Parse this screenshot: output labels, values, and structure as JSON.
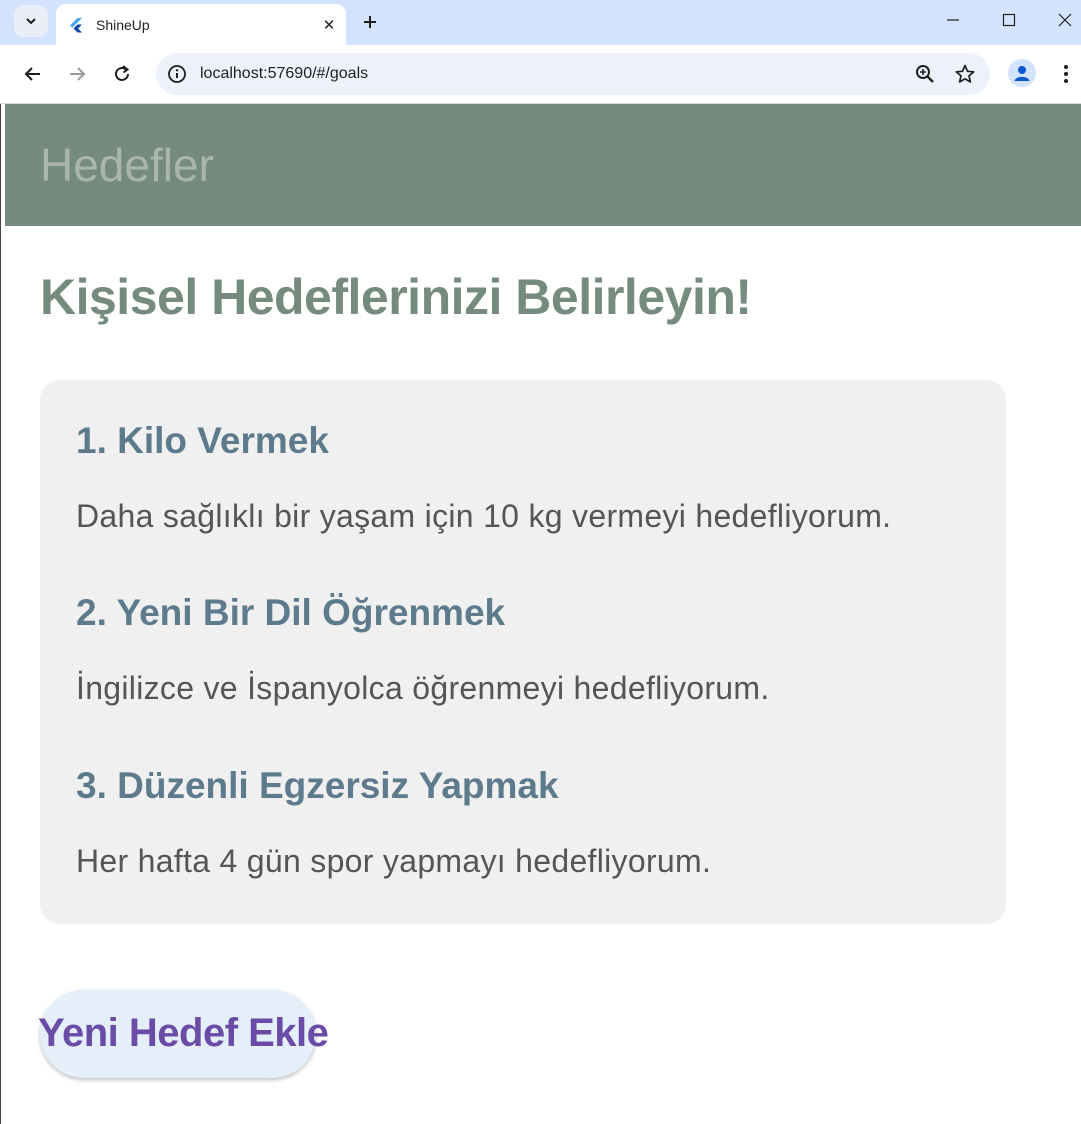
{
  "browser": {
    "tab_title": "ShineUp",
    "url": "localhost:57690/#/goals",
    "icons": {
      "tab_search": "chevron-down-icon",
      "favicon": "flutter-logo-icon",
      "close": "close-icon",
      "new_tab": "plus-icon",
      "back": "arrow-left-icon",
      "forward": "arrow-right-icon",
      "reload": "reload-icon",
      "site_info": "info-icon",
      "zoom": "zoom-icon",
      "bookmark": "star-icon",
      "profile": "person-icon",
      "menu": "more-vert-icon"
    }
  },
  "appbar": {
    "title": "Hedefler"
  },
  "page": {
    "heading": "Kişisel Hedeflerinizi Belirleyin!"
  },
  "goals": [
    {
      "title": "1. Kilo Vermek",
      "description": "Daha sağlıklı bir yaşam için 10 kg vermeyi hedefliyorum."
    },
    {
      "title": "2. Yeni Bir Dil Öğrenmek",
      "description": "İngilizce ve İspanyolca öğrenmeyi hedefliyorum."
    },
    {
      "title": "3. Düzenli Egzersiz Yapmak",
      "description": "Her hafta 4 gün spor yapmayı hedefliyorum."
    }
  ],
  "actions": {
    "add_goal_label": "Yeni Hedef Ekle"
  },
  "colors": {
    "appbar_bg": "#758b7e",
    "heading": "#758b7e",
    "goal_title": "#5d7b8c",
    "goal_text": "#555555",
    "card_bg": "#f0f0f0",
    "button_bg": "#e4effa",
    "button_text": "#6a4ca6"
  }
}
